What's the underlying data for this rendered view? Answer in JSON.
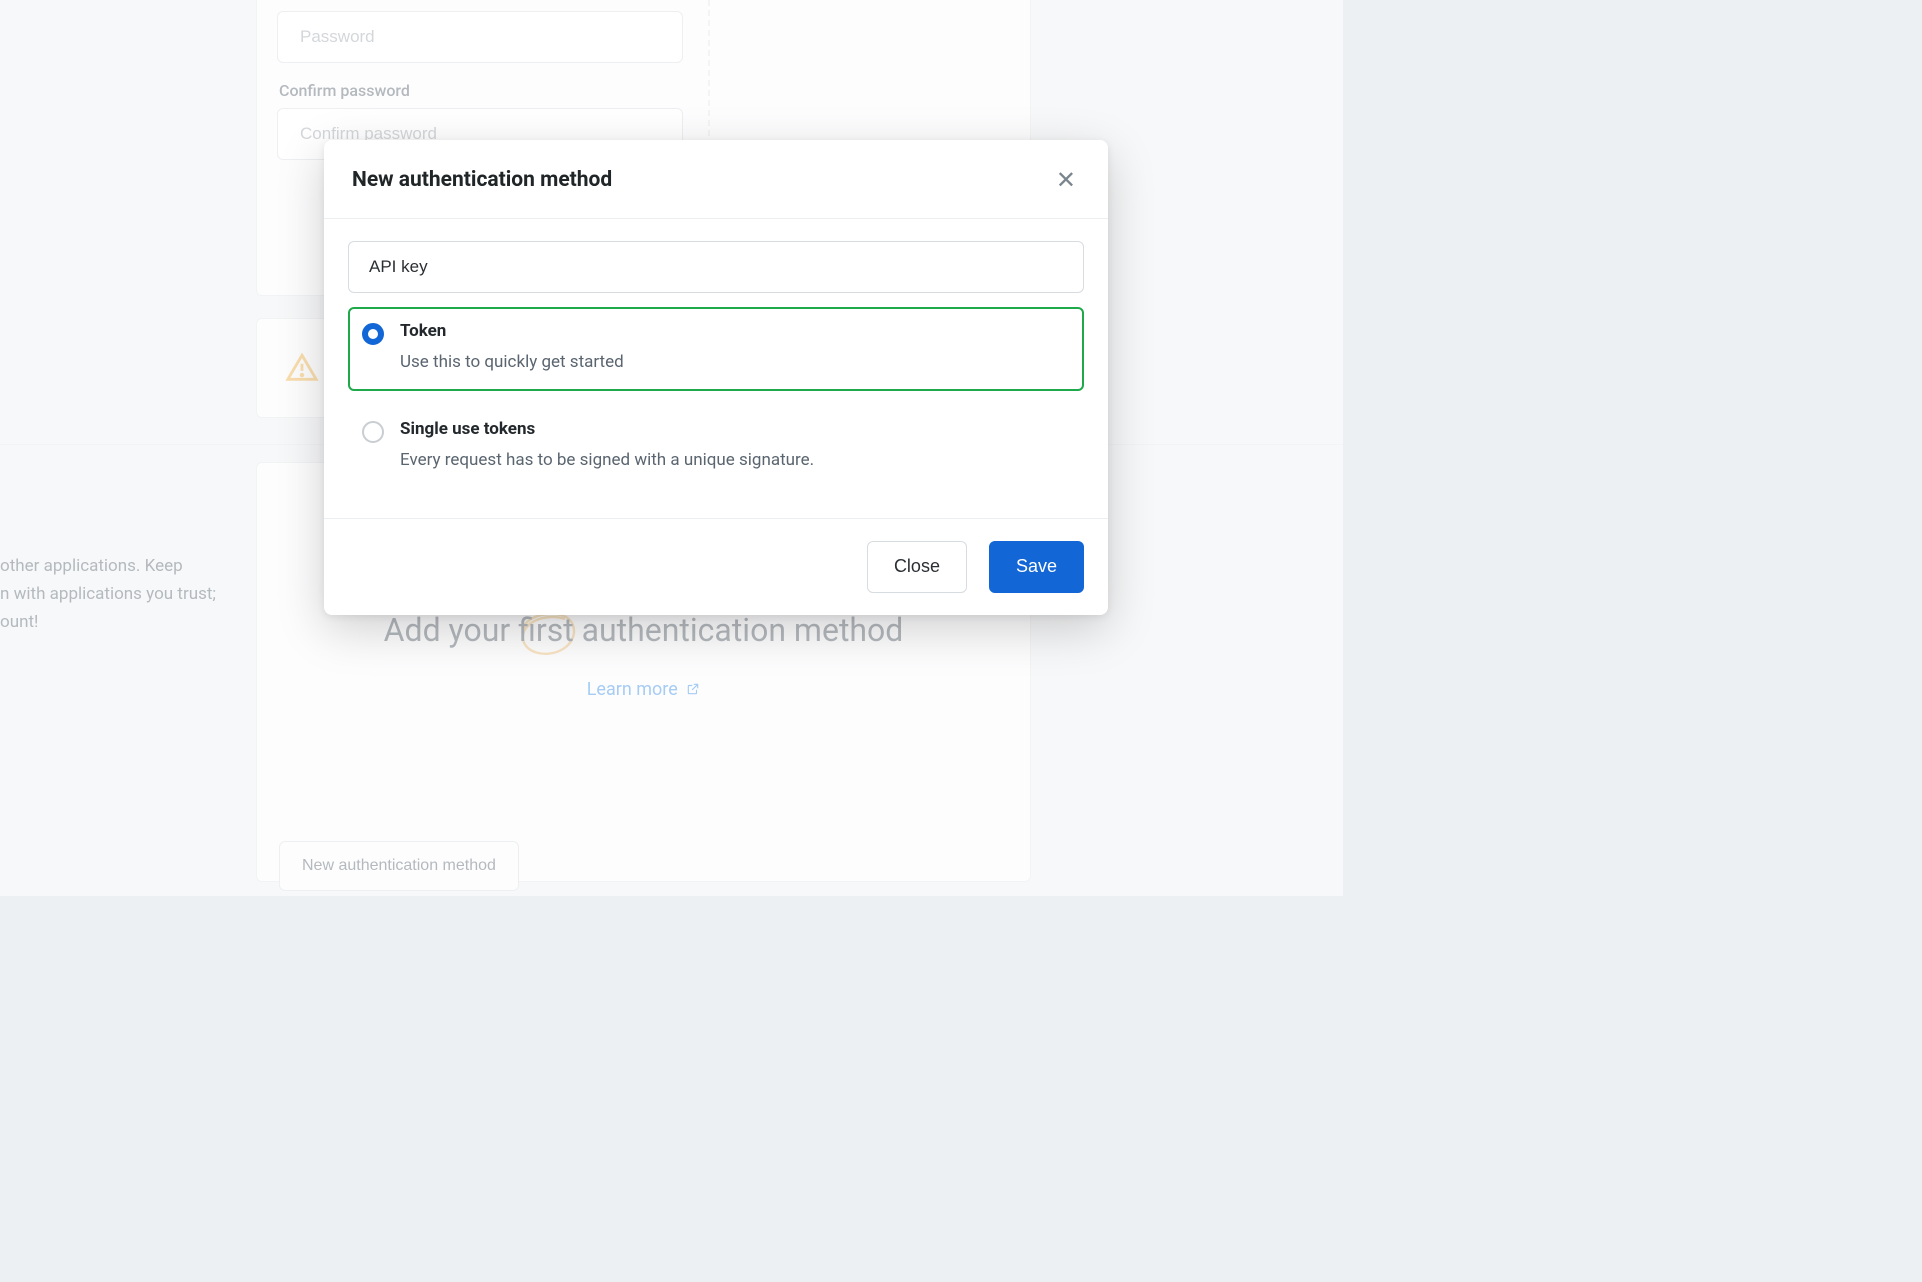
{
  "bg": {
    "password_placeholder": "Password",
    "confirm_label": "Confirm password",
    "confirm_placeholder": "Confirm password",
    "side_text_line1": "other applications. Keep",
    "side_text_line2": "n with applications you trust;",
    "side_text_line3": "ount!",
    "lower_heading": "Add your first authentication method",
    "learn_more": "Learn more",
    "new_method_button": "New authentication method"
  },
  "modal": {
    "title": "New authentication method",
    "name_value": "API key",
    "options": [
      {
        "title": "Token",
        "desc": "Use this to quickly get started",
        "selected": true
      },
      {
        "title": "Single use tokens",
        "desc": "Every request has to be signed with a unique signature.",
        "selected": false
      }
    ],
    "close_label": "Close",
    "save_label": "Save"
  }
}
